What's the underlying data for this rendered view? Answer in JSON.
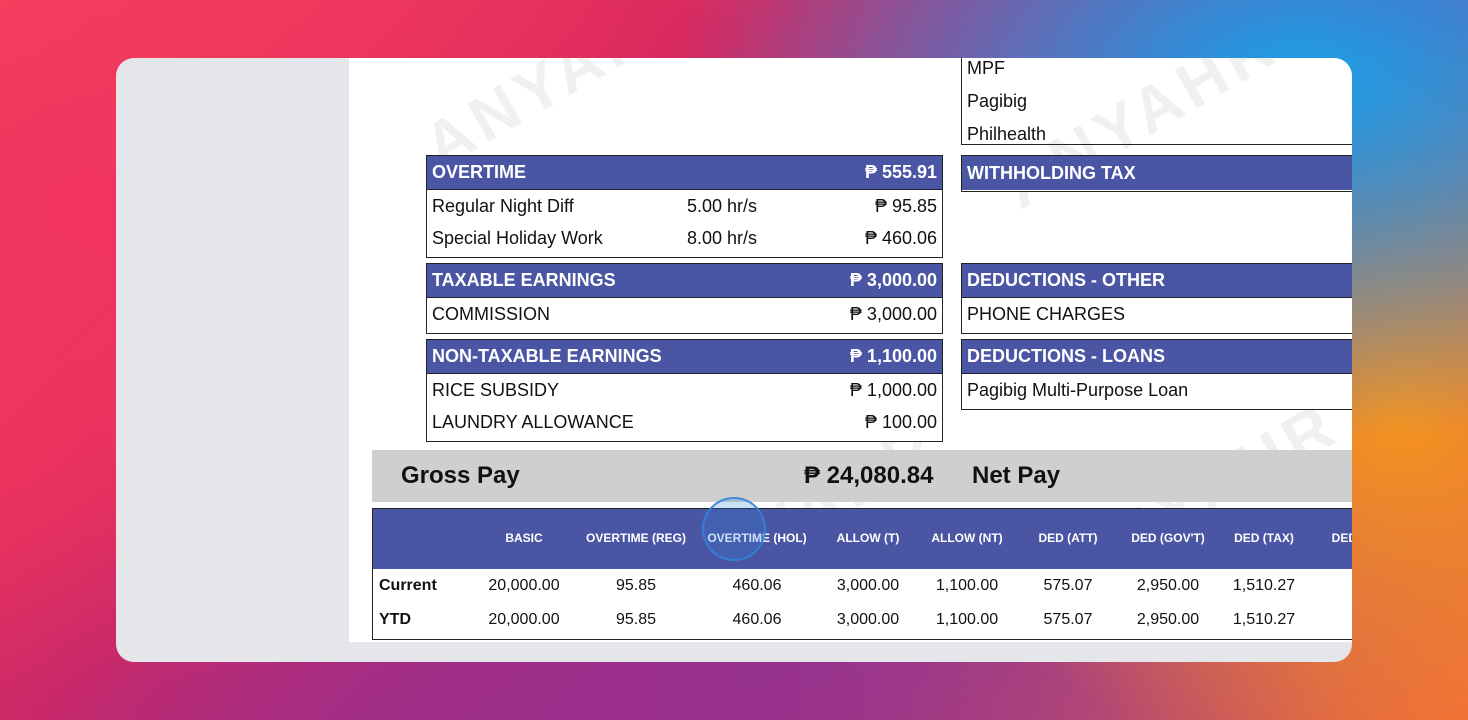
{
  "top_deductions": [
    "MPF",
    "Pagibig",
    "Philhealth"
  ],
  "overtime": {
    "title": "OVERTIME",
    "total": "₱ 555.91",
    "rows": [
      {
        "label": "Regular Night Diff",
        "hours": "5.00 hr/s",
        "amount": "₱ 95.85"
      },
      {
        "label": "Special Holiday Work",
        "hours": "8.00 hr/s",
        "amount": "₱ 460.06"
      }
    ]
  },
  "withholding_tax": {
    "title": "WITHHOLDING TAX"
  },
  "taxable": {
    "title": "TAXABLE EARNINGS",
    "total": "₱ 3,000.00",
    "rows": [
      {
        "label": "COMMISSION",
        "amount": "₱ 3,000.00"
      }
    ]
  },
  "deductions_other": {
    "title": "DEDUCTIONS - OTHER",
    "rows": [
      {
        "label": "PHONE CHARGES"
      }
    ]
  },
  "non_taxable": {
    "title": "NON-TAXABLE EARNINGS",
    "total": "₱ 1,100.00",
    "rows": [
      {
        "label": "RICE SUBSIDY",
        "amount": "₱ 1,000.00"
      },
      {
        "label": "LAUNDRY ALLOWANCE",
        "amount": "₱ 100.00"
      }
    ]
  },
  "deductions_loans": {
    "title": "DEDUCTIONS - LOANS",
    "rows": [
      {
        "label": "Pagibig Multi-Purpose Loan"
      }
    ]
  },
  "gross": {
    "label": "Gross Pay",
    "value": "₱ 24,080.84",
    "net_label": "Net Pay"
  },
  "summary": {
    "columns": [
      "BASIC",
      "OVERTIME (REG)",
      "OVERTIME (HOL)",
      "ALLOW (T)",
      "ALLOW (NT)",
      "DED (ATT)",
      "DED (GOV'T)",
      "DED (TAX)",
      "DED ("
    ],
    "rows": [
      {
        "label": "Current",
        "values": [
          "20,000.00",
          "95.85",
          "460.06",
          "3,000.00",
          "1,100.00",
          "575.07",
          "2,950.00",
          "1,510.27",
          "("
        ]
      },
      {
        "label": "YTD",
        "values": [
          "20,000.00",
          "95.85",
          "460.06",
          "3,000.00",
          "1,100.00",
          "575.07",
          "2,950.00",
          "1,510.27",
          "("
        ]
      }
    ]
  }
}
